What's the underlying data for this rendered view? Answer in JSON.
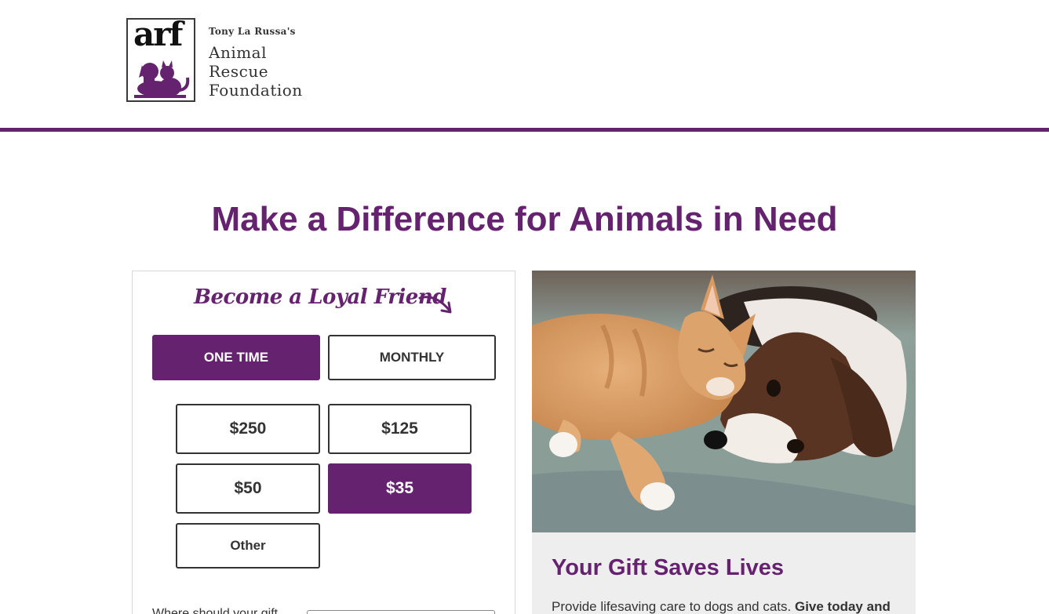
{
  "header": {
    "logo_mark": "arf",
    "logo_small": "Tony La Russa's",
    "logo_lines": [
      "Animal",
      "Rescue",
      "Foundation"
    ],
    "accent_color": "#65236f"
  },
  "headline": "Make a Difference for Animals in Need",
  "form": {
    "tagline": "Become a Loyal Friend",
    "frequency": {
      "options": [
        "ONE TIME",
        "MONTHLY"
      ],
      "selected": "ONE TIME"
    },
    "amounts": {
      "options": [
        "$250",
        "$125",
        "$50",
        "$35",
        "Other"
      ],
      "selected": "$35"
    },
    "designation_label": "Where should your gift"
  },
  "hero_image": {
    "alt_icon": "cat-and-dog-photo"
  },
  "info": {
    "title": "Your Gift Saves Lives",
    "body_plain": "Provide lifesaving care to dogs and cats.",
    "body_bold": "Give today and"
  }
}
